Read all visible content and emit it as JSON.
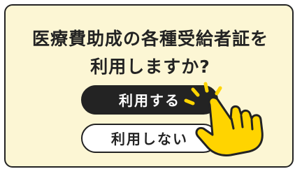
{
  "dialog": {
    "title_line1": "医療費助成の各種受給者証を",
    "title_line2": "利用しますか?"
  },
  "buttons": {
    "use_label": "利用する",
    "not_use_label": "利用しない"
  },
  "colors": {
    "background": "#fcf6d4",
    "ink": "#232323",
    "hand": "#ffd400"
  },
  "icons": {
    "pointer": "pointing-hand-icon",
    "sparkle": "sparkle-lines-icon"
  }
}
